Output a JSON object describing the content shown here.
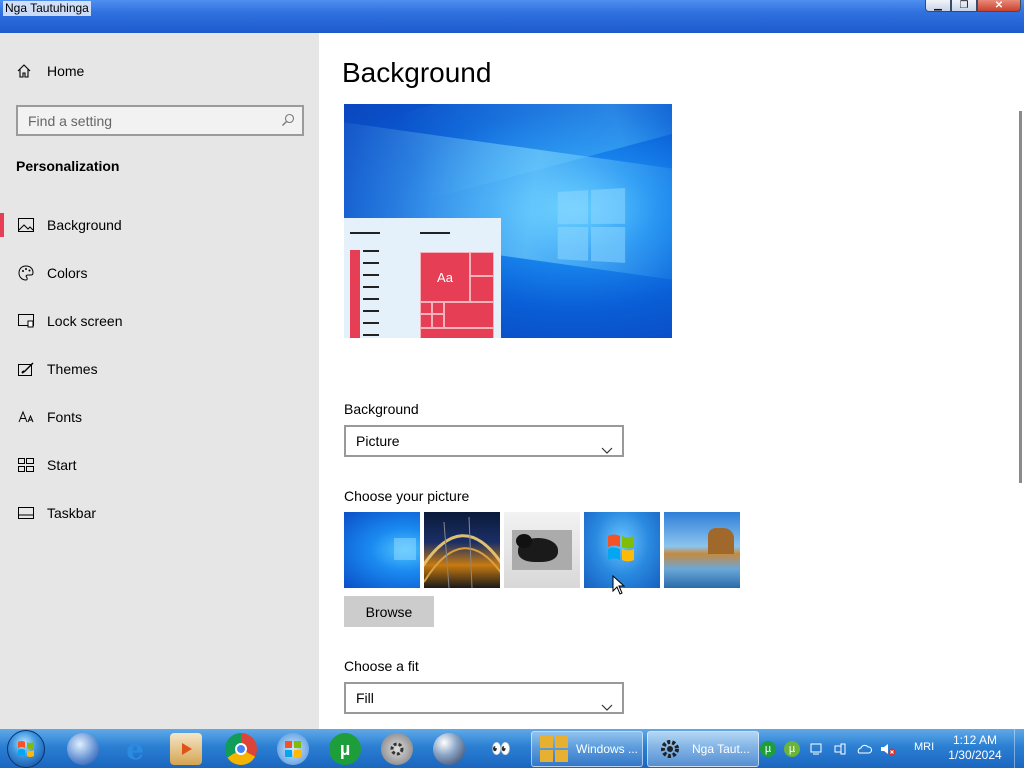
{
  "window": {
    "title": "Nga Tautuhinga",
    "min_label": "▁",
    "max_label": "❐",
    "close_label": "✕"
  },
  "sidebar": {
    "home_label": "Home",
    "search_placeholder": "Find a setting",
    "section_title": "Personalization",
    "items": [
      {
        "label": "Background",
        "icon": "picture-icon",
        "active": true
      },
      {
        "label": "Colors",
        "icon": "palette-icon"
      },
      {
        "label": "Lock screen",
        "icon": "lock-screen-icon"
      },
      {
        "label": "Themes",
        "icon": "brush-icon"
      },
      {
        "label": "Fonts",
        "icon": "font-icon"
      },
      {
        "label": "Start",
        "icon": "start-icon"
      },
      {
        "label": "Taskbar",
        "icon": "taskbar-icon"
      }
    ]
  },
  "main": {
    "page_title": "Background",
    "preview_tile_text": "Aa",
    "background_label": "Background",
    "background_value": "Picture",
    "choose_picture_label": "Choose your picture",
    "browse_label": "Browse",
    "choose_fit_label": "Choose a fit",
    "fit_value": "Fill"
  },
  "taskbar": {
    "tasks": [
      {
        "label": "Windows ..."
      },
      {
        "label": "Nga Taut..."
      }
    ],
    "language": "MRI",
    "time": "1:12 AM",
    "date": "1/30/2024"
  },
  "colors": {
    "accent": "#e63e55",
    "sidebar_bg": "#e6e6e6",
    "taskbar": "#2b7fd3"
  }
}
